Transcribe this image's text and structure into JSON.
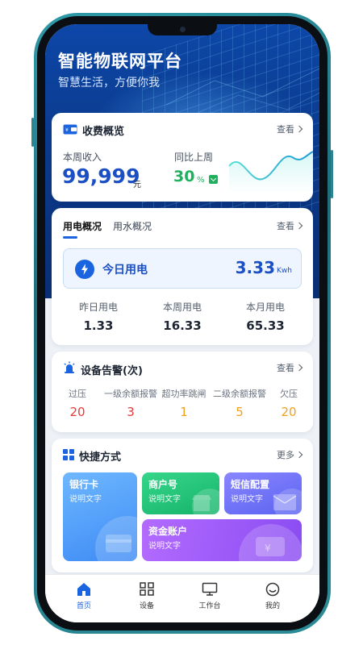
{
  "hero": {
    "title": "智能物联网平台",
    "subtitle": "智慧生活，方便你我"
  },
  "fee": {
    "title": "收费概览",
    "view_label": "查看",
    "week_income_label": "本周收入",
    "week_income_value": "99,999",
    "week_income_unit": "元",
    "yoy_label": "同比上周",
    "yoy_value": "30",
    "yoy_unit": "%",
    "yoy_direction": "down",
    "accent_color": "#1b4fc4",
    "positive_color": "#1fb15d"
  },
  "power": {
    "tabs": [
      {
        "label": "用电概况",
        "active": true
      },
      {
        "label": "用水概况",
        "active": false
      }
    ],
    "view_label": "查看",
    "today_label": "今日用电",
    "today_value": "3.33",
    "today_unit": "Kwh",
    "stats": [
      {
        "label": "昨日用电",
        "value": "1.33"
      },
      {
        "label": "本周用电",
        "value": "16.33"
      },
      {
        "label": "本月用电",
        "value": "65.33"
      }
    ]
  },
  "alarm": {
    "title": "设备告警(次)",
    "view_label": "查看",
    "items": [
      {
        "label": "过压",
        "value": "20",
        "color": "#e23b3b"
      },
      {
        "label": "一级余额报警",
        "value": "3",
        "color": "#e23b3b"
      },
      {
        "label": "超功率跳闸",
        "value": "1",
        "color": "#f0a020"
      },
      {
        "label": "二级余额报警",
        "value": "5",
        "color": "#f0a020"
      },
      {
        "label": "欠压",
        "value": "20",
        "color": "#f0a020"
      }
    ]
  },
  "shortcuts": {
    "title": "快捷方式",
    "more_label": "更多",
    "tiles": [
      {
        "title": "银行卡",
        "desc": "说明文字",
        "icon": "bank-card-icon"
      },
      {
        "title": "商户号",
        "desc": "说明文字",
        "icon": "shop-icon"
      },
      {
        "title": "短信配置",
        "desc": "说明文字",
        "icon": "mail-icon"
      },
      {
        "title": "资金账户",
        "desc": "说明文字",
        "icon": "wallet-icon"
      }
    ]
  },
  "nav": {
    "items": [
      {
        "label": "首页",
        "icon": "home-icon",
        "active": true
      },
      {
        "label": "设备",
        "icon": "devices-icon",
        "active": false
      },
      {
        "label": "工作台",
        "icon": "monitor-icon",
        "active": false
      },
      {
        "label": "我的",
        "icon": "smile-icon",
        "active": false
      }
    ]
  }
}
